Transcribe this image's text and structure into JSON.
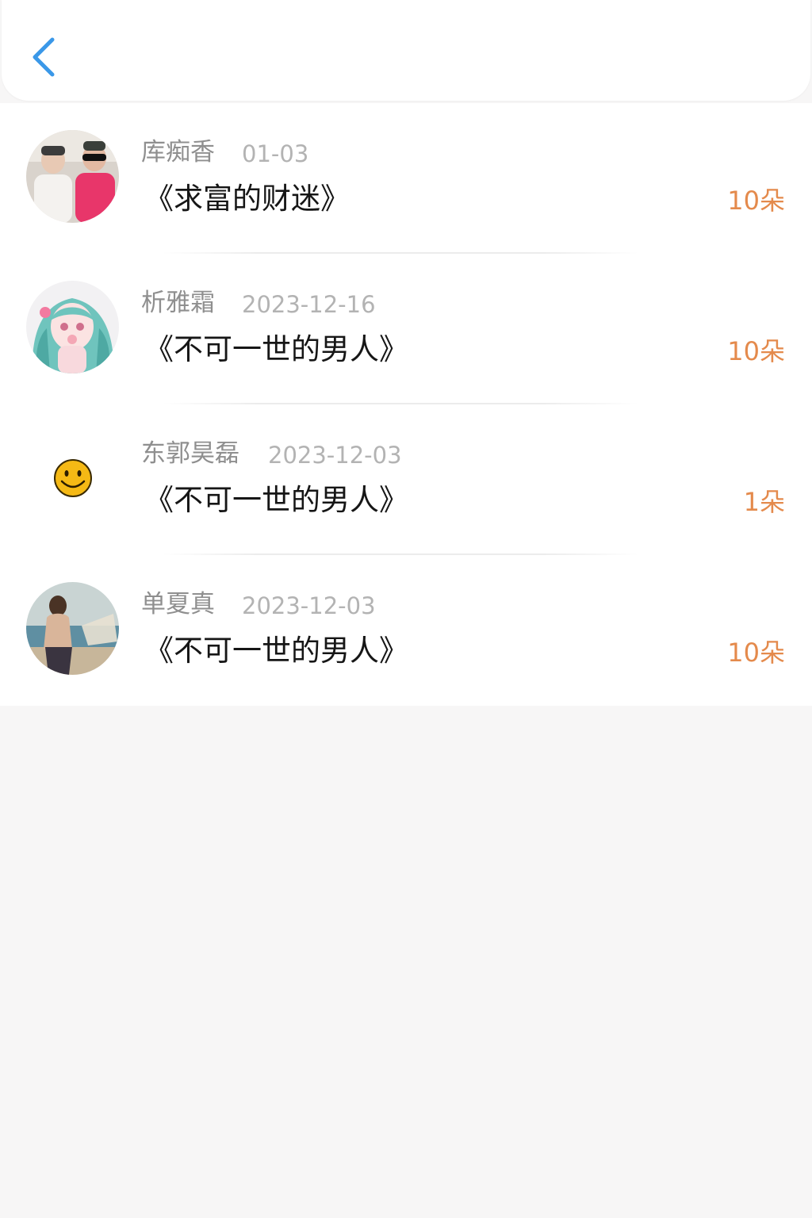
{
  "header": {
    "back_icon": "chevron-left-icon",
    "accent_color": "#3a98e8"
  },
  "colors": {
    "gift_count": "#e48a4c",
    "name": "#8f8f8f",
    "date": "#b3b3b3",
    "title": "#161616"
  },
  "records": [
    {
      "name": "库痴香",
      "date": "01-03",
      "book": "《求富的财迷》",
      "gift": "10朵",
      "avatar": "photo-avatar"
    },
    {
      "name": "析雅霜",
      "date": "2023-12-16",
      "book": "《不可一世的男人》",
      "gift": "10朵",
      "avatar": "anime-avatar"
    },
    {
      "name": "东郭昊磊",
      "date": "2023-12-03",
      "book": "《不可一世的男人》",
      "gift": "1朵",
      "avatar": "smiley-avatar"
    },
    {
      "name": "单夏真",
      "date": "2023-12-03",
      "book": "《不可一世的男人》",
      "gift": "10朵",
      "avatar": "beach-photo-avatar"
    }
  ]
}
